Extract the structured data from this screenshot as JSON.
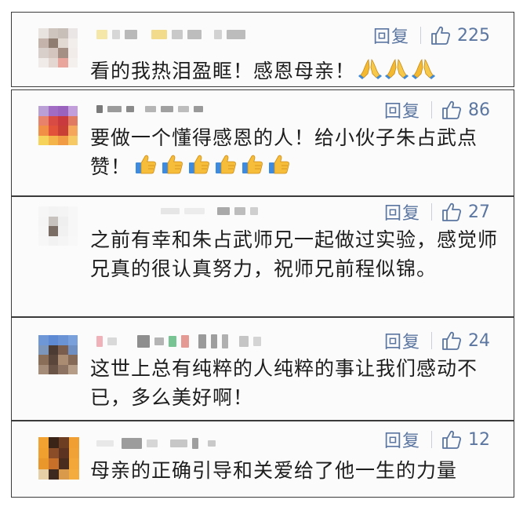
{
  "comments": [
    {
      "reply_label": "回复",
      "likes": "225",
      "text": "看的我热泪盈眶！感恩母亲！",
      "emoji": "praying-hands",
      "emoji_count": 3
    },
    {
      "reply_label": "回复",
      "likes": "86",
      "text": "要做一个懂得感恩的人！给小伙子朱占武点赞！",
      "emoji": "thumbs-up",
      "emoji_count": 6
    },
    {
      "reply_label": "回复",
      "likes": "27",
      "text": "之前有幸和朱占武师兄一起做过实验，感觉师兄真的很认真努力，祝师兄前程似锦。",
      "emoji": "",
      "emoji_count": 0
    },
    {
      "reply_label": "回复",
      "likes": "24",
      "text": "这世上总有纯粹的人纯粹的事让我们感动不已，多么美好啊！",
      "emoji": "",
      "emoji_count": 0
    },
    {
      "reply_label": "回复",
      "likes": "12",
      "text": "母亲的正确引导和关爱给了他一生的力量",
      "emoji": "",
      "emoji_count": 0
    }
  ],
  "colors": {
    "action_blue": "#5b76a0",
    "text": "#1d1d1d",
    "border": "#3a3a3a"
  }
}
